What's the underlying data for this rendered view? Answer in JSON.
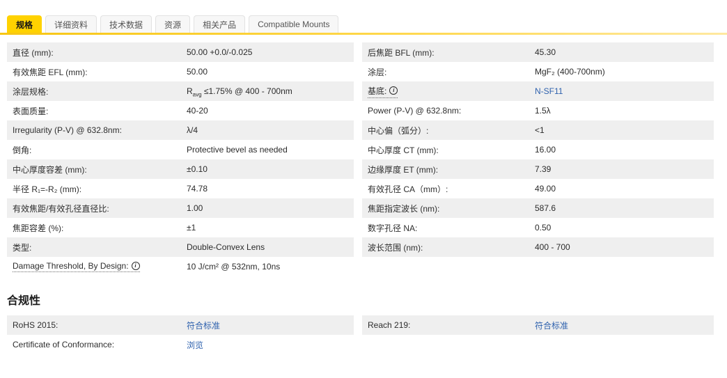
{
  "tabs": [
    {
      "name": "tab-specs",
      "label": "规格",
      "active": true
    },
    {
      "name": "tab-details",
      "label": "详细资料",
      "active": false
    },
    {
      "name": "tab-technical-data",
      "label": "技术数据",
      "active": false
    },
    {
      "name": "tab-resources",
      "label": "资源",
      "active": false
    },
    {
      "name": "tab-related-products",
      "label": "相关产品",
      "active": false
    },
    {
      "name": "tab-compatible-mounts",
      "label": "Compatible Mounts",
      "active": false
    }
  ],
  "specs": {
    "left": [
      {
        "label": "直径 (mm):",
        "value": "50.00 +0.0/-0.025"
      },
      {
        "label": "有效焦距 EFL (mm):",
        "value": "50.00"
      },
      {
        "label": "涂层规格:",
        "value_html": "R<sub>avg</sub> ≤1.75% @ 400 - 700nm"
      },
      {
        "label": "表面质量:",
        "value": "40-20"
      },
      {
        "label": "Irregularity (P-V) @ 632.8nm:",
        "value": "λ/4"
      },
      {
        "label": "倒角:",
        "value": "Protective bevel as needed"
      },
      {
        "label": "中心厚度容差 (mm):",
        "value": "±0.10"
      },
      {
        "label": "半径 R₁=-R₂ (mm):",
        "value": "74.78"
      },
      {
        "label": "有效焦距/有效孔径直径比:",
        "value": "1.00"
      },
      {
        "label": "焦距容差 (%):",
        "value": "±1"
      },
      {
        "label": "类型:",
        "value": "Double-Convex Lens"
      },
      {
        "label": "Damage Threshold, By Design:",
        "value": "10 J/cm² @ 532nm, 10ns",
        "info": true,
        "info_name": "damage-threshold-info-icon"
      }
    ],
    "right": [
      {
        "label": "后焦距 BFL (mm):",
        "value": "45.30"
      },
      {
        "label": "涂层:",
        "value": "MgF₂ (400-700nm)"
      },
      {
        "label": "基底:",
        "value": "N-SF11",
        "info": true,
        "info_name": "substrate-info-icon",
        "link": true,
        "name": "substrate-link"
      },
      {
        "label": "Power (P-V) @ 632.8nm:",
        "value": "1.5λ"
      },
      {
        "label": "中心偏（弧分）:",
        "value": "<1"
      },
      {
        "label": "中心厚度 CT (mm):",
        "value": "16.00"
      },
      {
        "label": "边缘厚度 ET (mm):",
        "value": "7.39"
      },
      {
        "label": "有效孔径 CA（mm）:",
        "value": "49.00"
      },
      {
        "label": "焦距指定波长 (nm):",
        "value": "587.6"
      },
      {
        "label": "数字孔径 NA:",
        "value": "0.50"
      },
      {
        "label": "波长范围 (nm):",
        "value": "400 - 700"
      }
    ]
  },
  "compliance": {
    "heading": "合规性",
    "left": [
      {
        "label": "RoHS 2015:",
        "value": "符合标准",
        "link": true,
        "name": "rohs-2015-link"
      },
      {
        "label": "Certificate of Conformance:",
        "value": "浏览",
        "link": true,
        "name": "certificate-of-conformance-link"
      }
    ],
    "right": [
      {
        "label": "Reach 219:",
        "value": "符合标准",
        "link": true,
        "name": "reach-219-link"
      }
    ]
  },
  "colors": {
    "accent_yellow": "#ffd200",
    "row_stripe": "#efefef",
    "link_blue": "#2f62ae"
  }
}
